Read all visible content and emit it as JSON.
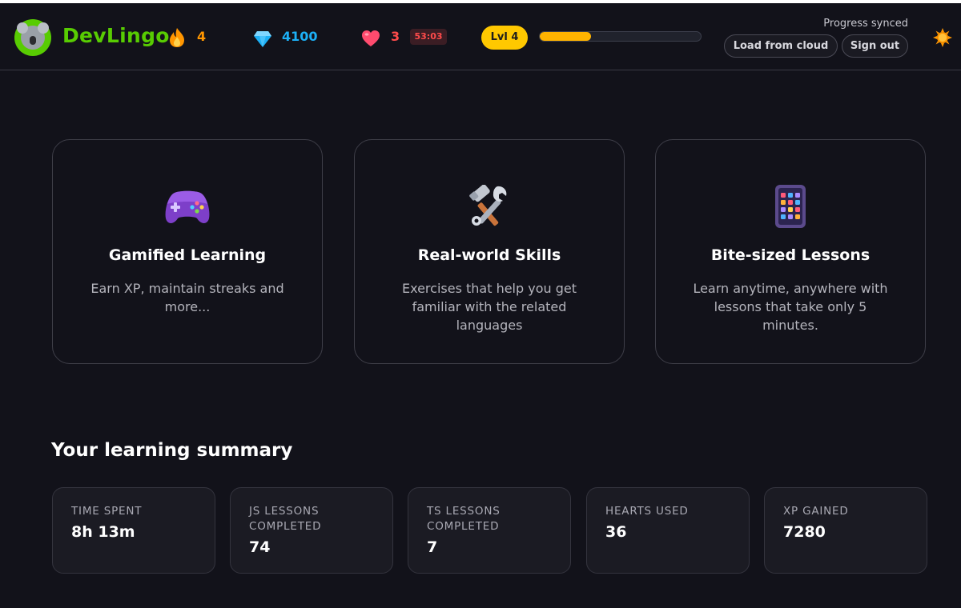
{
  "header": {
    "logo_text": "DevLingo",
    "streak": "4",
    "gems": "4100",
    "hearts": "3",
    "heart_timer": "53:03",
    "level": "Lvl 4",
    "level_progress": 0.32,
    "sync_status": "Progress synced",
    "load_button": "Load from cloud",
    "signout_button": "Sign out"
  },
  "features": [
    {
      "icon": "game-controller-icon",
      "title": "Gamified Learning",
      "description": "Earn XP, maintain streaks and more..."
    },
    {
      "icon": "tools-icon",
      "title": "Real-world Skills",
      "description": "Exercises that help you get familiar with the related languages"
    },
    {
      "icon": "tablet-icon",
      "title": "Bite-sized Lessons",
      "description": "Learn anytime, anywhere with lessons that take only 5 minutes."
    }
  ],
  "summary": {
    "title": "Your learning summary",
    "stats": [
      {
        "label": "TIME SPENT",
        "value": "8h 13m"
      },
      {
        "label": "JS LESSONS COMPLETED",
        "value": "74"
      },
      {
        "label": "TS LESSONS COMPLETED",
        "value": "7"
      },
      {
        "label": "HEARTS USED",
        "value": "36"
      },
      {
        "label": "XP GAINED",
        "value": "7280"
      }
    ]
  },
  "colors": {
    "brand_green": "#58cc02",
    "streak_orange": "#ff9600",
    "gem_blue": "#1cb0f6",
    "heart_red": "#ff4b4b",
    "level_yellow": "#ffc800",
    "background": "#12121a"
  }
}
